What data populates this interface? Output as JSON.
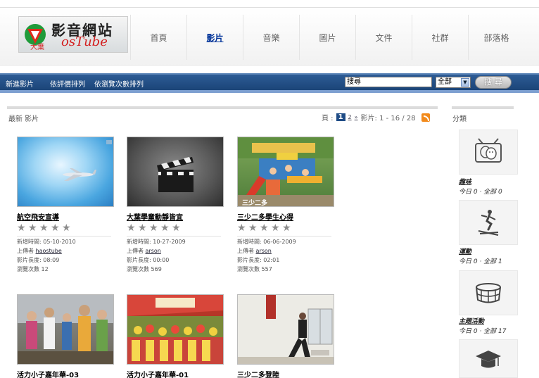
{
  "logo": {
    "main": "影音網站",
    "sub": "osTube",
    "small": "大葉"
  },
  "nav": [
    "首頁",
    "影片",
    "音樂",
    "圖片",
    "文件",
    "社群",
    "部落格"
  ],
  "nav_active": 1,
  "toolbar": {
    "links": [
      "新進影片",
      "依評價排列",
      "依瀏覽次數排列"
    ],
    "search_value": "搜尋",
    "select_value": "全部",
    "search_button": "搜 尋"
  },
  "section": {
    "title": "最新 影片",
    "page_label": "頁 :",
    "pages": [
      "1",
      "2",
      "»"
    ],
    "range": "影片: 1 - 16 / 28"
  },
  "videos": [
    {
      "title": "航空飛安宣導",
      "date": "新增時間: 05-10-2010",
      "uploader_label": "上傳者",
      "uploader": "haostube",
      "length": "影片長度: 08:09",
      "views": "瀏覽次數 12",
      "rating": 0
    },
    {
      "title": "大葉學童動靜皆宜",
      "date": "新增時間: 10-27-2009",
      "uploader_label": "上傳者",
      "uploader": "arson",
      "length": "影片長度: 00:00",
      "views": "瀏覽次數 569",
      "rating": 0
    },
    {
      "title": "三少二多學生心得",
      "date": "新增時間: 06-06-2009",
      "uploader_label": "上傳者",
      "uploader": "arson",
      "length": "影片長度: 02:01",
      "views": "瀏覽次數 557",
      "rating": 0
    },
    {
      "title": "活力小子嘉年華-03"
    },
    {
      "title": "活力小子嘉年華-01"
    },
    {
      "title": "三少二多登陸"
    }
  ],
  "sidebar": {
    "title": "分類",
    "categories": [
      {
        "name": "趣味",
        "count": "今日 0 · 全部 0",
        "icon": "theater-masks-tv-icon"
      },
      {
        "name": "運動",
        "count": "今日 0 · 全部 1",
        "icon": "skier-icon"
      },
      {
        "name": "主題活動",
        "count": "今日 0 · 全部 17",
        "icon": "stadium-icon"
      },
      {
        "name": "",
        "count": "",
        "icon": "graduation-cap-icon"
      }
    ]
  },
  "colors": {
    "toolbar": "#1f4c86",
    "accent_red": "#d42020",
    "rss": "#f28a1b"
  }
}
